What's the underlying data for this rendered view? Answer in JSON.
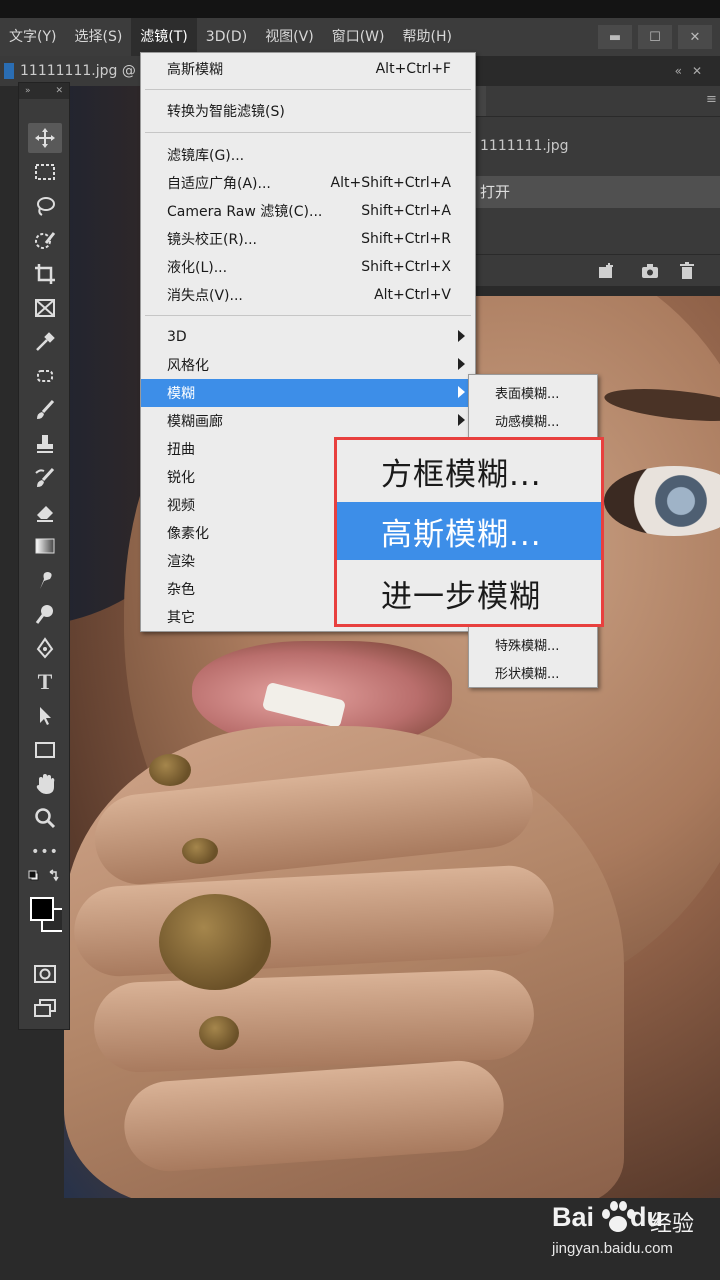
{
  "menubar": {
    "items": [
      "文字(Y)",
      "选择(S)",
      "滤镜(T)",
      "3D(D)",
      "视图(V)",
      "窗口(W)",
      "帮助(H)"
    ],
    "active_index": 2
  },
  "window_controls": {
    "minimize": "▬",
    "maximize": "☐",
    "close": "✕"
  },
  "document": {
    "tab_label": "11111111.jpg @"
  },
  "toolbar": {
    "collapse": "»",
    "close": "✕",
    "tools": [
      "move-icon",
      "marquee-icon",
      "lasso-icon",
      "quick-select-icon",
      "crop-icon",
      "frame-icon",
      "eyedropper-icon",
      "healing-icon",
      "brush-icon",
      "stamp-icon",
      "history-brush-icon",
      "eraser-icon",
      "gradient-icon",
      "smudge-icon",
      "dodge-icon",
      "pen-icon",
      "type-icon",
      "path-select-icon",
      "rectangle-icon",
      "hand-icon",
      "zoom-icon",
      "more-icon",
      "swap-colors-icon",
      "color-swatches-icon",
      "quick-mask-icon",
      "screen-mode-icon"
    ],
    "type_glyph": "T",
    "more_glyph": "•••"
  },
  "filter_menu": {
    "items": [
      {
        "label": "高斯模糊",
        "shortcut": "Alt+Ctrl+F"
      },
      {
        "label": "转换为智能滤镜(S)",
        "shortcut": ""
      },
      {
        "label": "滤镜库(G)...",
        "shortcut": ""
      },
      {
        "label": "自适应广角(A)...",
        "shortcut": "Alt+Shift+Ctrl+A"
      },
      {
        "label": "Camera Raw 滤镜(C)...",
        "shortcut": "Shift+Ctrl+A"
      },
      {
        "label": "镜头校正(R)...",
        "shortcut": "Shift+Ctrl+R"
      },
      {
        "label": "液化(L)...",
        "shortcut": "Shift+Ctrl+X"
      },
      {
        "label": "消失点(V)...",
        "shortcut": "Alt+Ctrl+V"
      },
      {
        "label": "3D",
        "shortcut": ""
      },
      {
        "label": "风格化",
        "shortcut": ""
      },
      {
        "label": "模糊",
        "shortcut": ""
      },
      {
        "label": "模糊画廊",
        "shortcut": ""
      },
      {
        "label": "扭曲",
        "shortcut": ""
      },
      {
        "label": "锐化",
        "shortcut": ""
      },
      {
        "label": "视频",
        "shortcut": ""
      },
      {
        "label": "像素化",
        "shortcut": ""
      },
      {
        "label": "渲染",
        "shortcut": ""
      },
      {
        "label": "杂色",
        "shortcut": ""
      },
      {
        "label": "其它",
        "shortcut": ""
      }
    ]
  },
  "blur_submenu": {
    "items": [
      "表面模糊...",
      "动感模糊...",
      "特殊模糊...",
      "形状模糊..."
    ]
  },
  "zoom_callout": {
    "items": [
      "方框模糊...",
      "高斯模糊...",
      "进一步模糊"
    ],
    "highlight_index": 1,
    "border_color": "#e8403e"
  },
  "right_panel": {
    "file_label": "1111111.jpg",
    "history_state": "打开",
    "collapse": "«",
    "close": "✕",
    "menu": "≡",
    "icons": [
      "new-snapshot-icon",
      "camera-icon",
      "trash-icon"
    ]
  },
  "watermark": {
    "logo": "Bai",
    "logo_suffix": "du",
    "brand_cn": "经验",
    "url": "jingyan.baidu.com"
  },
  "colors": {
    "highlight": "#3d8ee8",
    "menu_bg": "#ececec",
    "panel_bg": "#3b3b3b"
  }
}
